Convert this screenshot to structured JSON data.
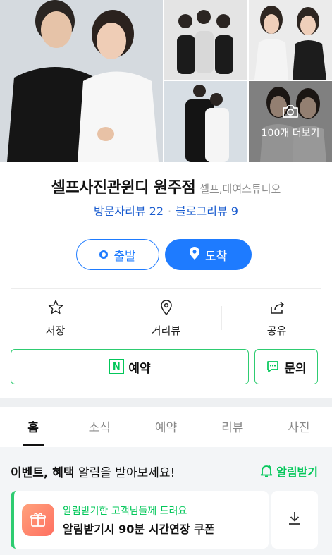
{
  "photos": {
    "more_label": "100개 더보기",
    "icons": [
      "camera-icon"
    ]
  },
  "place": {
    "name": "셀프사진관윈디 원주점",
    "category": "셀프,대여스튜디오",
    "visitor_reviews": "방문자리뷰 22",
    "blog_reviews": "블로그리뷰 9",
    "separator": "·"
  },
  "route": {
    "depart_label": "출발",
    "arrive_label": "도착"
  },
  "actions": [
    {
      "label": "저장",
      "icon": "star-icon"
    },
    {
      "label": "거리뷰",
      "icon": "pin-icon"
    },
    {
      "label": "공유",
      "icon": "share-icon"
    }
  ],
  "booking": {
    "reserve_label": "예약",
    "n_badge": "N",
    "inquiry_label": "문의"
  },
  "tabs": [
    {
      "label": "홈",
      "active": true
    },
    {
      "label": "소식",
      "active": false
    },
    {
      "label": "예약",
      "active": false
    },
    {
      "label": "리뷰",
      "active": false
    },
    {
      "label": "사진",
      "active": false
    }
  ],
  "event": {
    "title_bold": "이벤트, 혜택",
    "title_rest": " 알림을 받아보세요!",
    "notify_label": "알림받기",
    "coupon_sub": "알림받기한 고객님들께 드려요",
    "coupon_main": "알림받기시 90분 시간연장 쿠폰"
  },
  "colors": {
    "accent_blue": "#1e7bff",
    "naver_green": "#03c75a",
    "link_blue": "#1a5ccf"
  }
}
